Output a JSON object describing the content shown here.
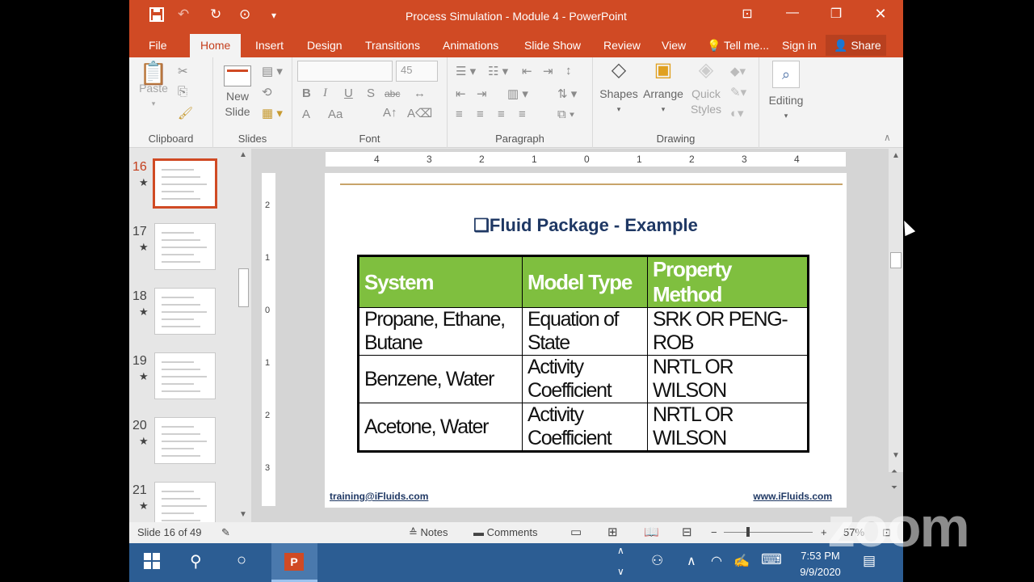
{
  "window": {
    "title": "Process Simulation - Module 4 - PowerPoint",
    "qat_icons": [
      "save-icon",
      "undo-icon",
      "redo-icon",
      "start-from-beginning-icon",
      "customize-qat-icon"
    ],
    "controls": [
      "ribbon-display-icon",
      "minimize-icon",
      "restore-icon",
      "close-icon"
    ]
  },
  "tabs": [
    {
      "label": "File",
      "active": false
    },
    {
      "label": "Home",
      "active": true
    },
    {
      "label": "Insert",
      "active": false
    },
    {
      "label": "Design",
      "active": false
    },
    {
      "label": "Transitions",
      "active": false
    },
    {
      "label": "Animations",
      "active": false
    },
    {
      "label": "Slide Show",
      "active": false
    },
    {
      "label": "Review",
      "active": false
    },
    {
      "label": "View",
      "active": false
    }
  ],
  "tell_me": "Tell me...",
  "sign_in": "Sign in",
  "share": "Share",
  "ribbon": {
    "clipboard": {
      "label": "Clipboard",
      "paste": "Paste"
    },
    "slides": {
      "label": "Slides",
      "new_slide_line1": "New",
      "new_slide_line2": "Slide"
    },
    "font": {
      "label": "Font",
      "size": "45",
      "bold": "B",
      "italic": "I",
      "underline": "U",
      "strike": "S",
      "abc": "abc",
      "font_color": "A",
      "change_case": "Aa"
    },
    "paragraph": {
      "label": "Paragraph"
    },
    "drawing": {
      "label": "Drawing",
      "shapes": "Shapes",
      "arrange": "Arrange",
      "quick_styles_line1": "Quick",
      "quick_styles_line2": "Styles"
    },
    "editing": {
      "label": "Editing"
    }
  },
  "thumbnails": [
    {
      "number": "16",
      "selected": true
    },
    {
      "number": "17",
      "selected": false
    },
    {
      "number": "18",
      "selected": false
    },
    {
      "number": "19",
      "selected": false
    },
    {
      "number": "20",
      "selected": false
    },
    {
      "number": "21",
      "selected": false
    }
  ],
  "ruler": {
    "h_labels": [
      "4",
      "3",
      "2",
      "1",
      "0",
      "1",
      "2",
      "3",
      "4"
    ],
    "v_labels": [
      "2",
      "1",
      "0",
      "1",
      "2",
      "3"
    ]
  },
  "slide": {
    "title": "Fluid Package - Example",
    "bullet": "❑",
    "table": {
      "headers": [
        "System",
        "Model Type",
        "Property Method"
      ],
      "rows": [
        [
          "Propane, Ethane, Butane",
          "Equation of State",
          "SRK OR PENG-ROB"
        ],
        [
          "Benzene, Water",
          "Activity Coefficient",
          "NRTL OR WILSON"
        ],
        [
          "Acetone, Water",
          "Activity Coefficient",
          "NRTL OR WILSON"
        ]
      ]
    },
    "footer_left": "training@iFluids.com",
    "footer_right": "www.iFluids.com"
  },
  "status": {
    "slide_info": "Slide 16 of 49",
    "notes": "Notes",
    "comments": "Comments",
    "zoom": "57%"
  },
  "taskbar": {
    "time": "7:53 PM",
    "date": "9/9/2020"
  },
  "watermark": "zoom"
}
